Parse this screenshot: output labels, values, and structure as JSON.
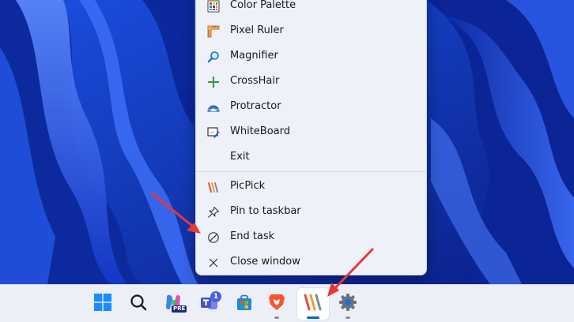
{
  "context_menu": {
    "items": [
      {
        "label": "Color Palette",
        "icon": "color-palette-icon"
      },
      {
        "label": "Pixel Ruler",
        "icon": "pixel-ruler-icon"
      },
      {
        "label": "Magnifier",
        "icon": "magnifier-icon"
      },
      {
        "label": "CrossHair",
        "icon": "crosshair-icon"
      },
      {
        "label": "Protractor",
        "icon": "protractor-icon"
      },
      {
        "label": "WhiteBoard",
        "icon": "whiteboard-icon"
      },
      {
        "label": "Exit",
        "icon": ""
      }
    ],
    "jump_items": [
      {
        "label": "PicPick",
        "icon": "picpick-icon"
      },
      {
        "label": "Pin to taskbar",
        "icon": "pin-icon"
      },
      {
        "label": "End task",
        "icon": "end-task-icon"
      },
      {
        "label": "Close window",
        "icon": "close-icon"
      }
    ]
  },
  "taskbar": {
    "apps": [
      {
        "name": "start",
        "icon": "windows-logo-icon"
      },
      {
        "name": "search",
        "icon": "search-icon"
      },
      {
        "name": "copilot",
        "icon": "copilot-icon",
        "tag": "PRE"
      },
      {
        "name": "teams",
        "icon": "teams-icon",
        "badge": "1"
      },
      {
        "name": "store",
        "icon": "store-icon"
      },
      {
        "name": "brave",
        "icon": "brave-icon"
      },
      {
        "name": "picpick",
        "icon": "picpick-icon",
        "active": true
      },
      {
        "name": "settings",
        "icon": "settings-icon"
      }
    ]
  },
  "colors": {
    "accent": "#0067c0",
    "arrow": "#e53935",
    "menu_bg": "#eef1f8",
    "taskbar_bg": "#eceff6"
  }
}
